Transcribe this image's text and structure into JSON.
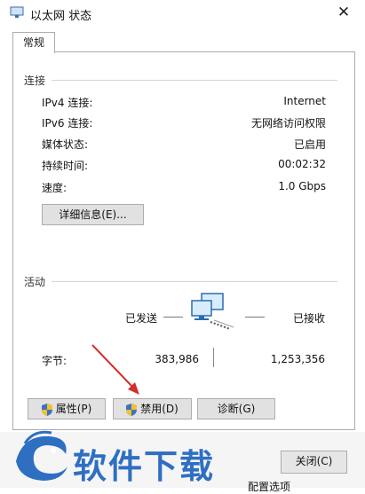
{
  "window": {
    "title": "以太网 状态"
  },
  "tab": {
    "label": "常规"
  },
  "connection": {
    "group_label": "连接",
    "rows": [
      {
        "label": "IPv4 连接:",
        "value": "Internet"
      },
      {
        "label": "IPv6 连接:",
        "value": "无网络访问权限"
      },
      {
        "label": "媒体状态:",
        "value": "已启用"
      },
      {
        "label": "持续时间:",
        "value": "00:02:32"
      },
      {
        "label": "速度:",
        "value": "1.0 Gbps"
      }
    ],
    "details_button": "详细信息(E)..."
  },
  "activity": {
    "group_label": "活动",
    "sent_label": "已发送",
    "received_label": "已接收",
    "bytes_label": "字节:",
    "bytes_sent": "383,986",
    "bytes_received": "1,253,356"
  },
  "buttons": {
    "properties": "属性(P)",
    "disable": "禁用(D)",
    "diagnose": "诊断(G)",
    "close": "关闭(C)"
  },
  "watermark": {
    "text": "软件下载"
  },
  "background_peek": {
    "text": "配置选项"
  },
  "colors": {
    "accent": "#2f6fc2",
    "arrow": "#d32f2f"
  }
}
